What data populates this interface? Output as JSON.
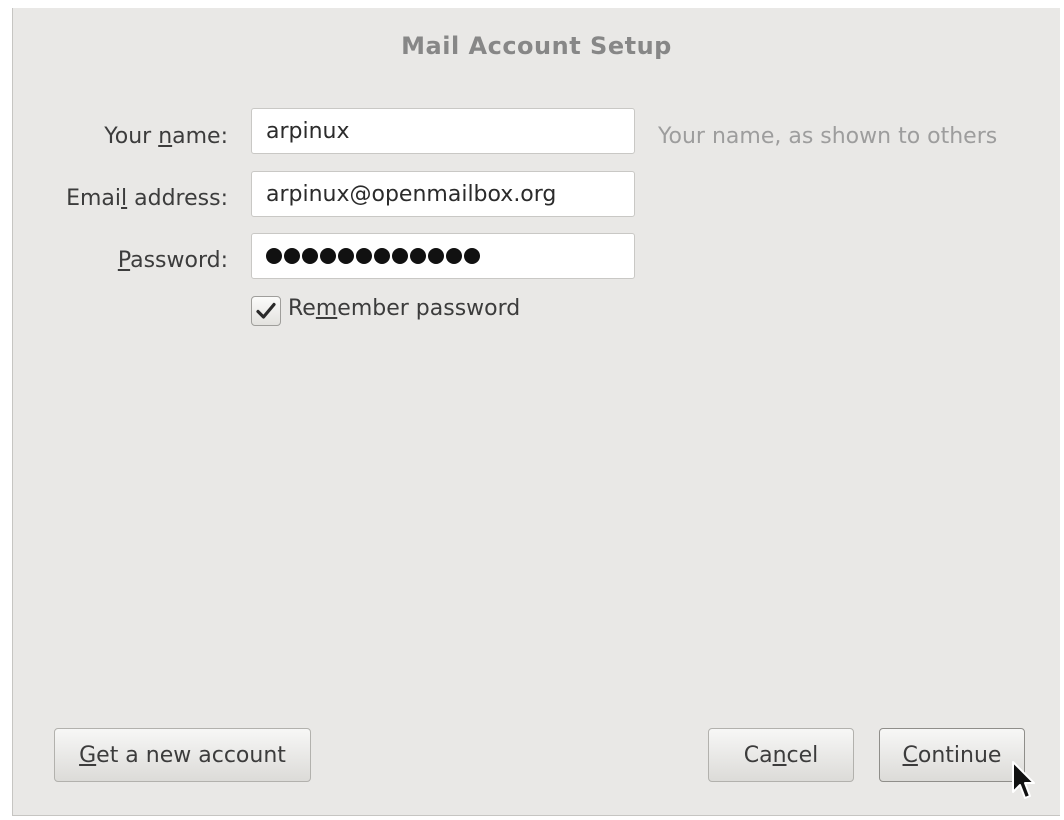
{
  "dialog": {
    "title": "Mail Account Setup"
  },
  "form": {
    "name": {
      "label_before": "Your ",
      "label_accel": "n",
      "label_after": "ame:",
      "value": "arpinux",
      "hint": "Your name, as shown to others"
    },
    "email": {
      "label_before": "Emai",
      "label_accel": "l",
      "label_after": " address:",
      "value": "arpinux@openmailbox.org"
    },
    "password": {
      "label_before": "",
      "label_accel": "P",
      "label_after": "assword:",
      "masked_length": 12
    },
    "remember": {
      "label_before": "Re",
      "label_accel": "m",
      "label_after": "ember password",
      "checked": true
    }
  },
  "buttons": {
    "new_account": {
      "before": "",
      "accel": "G",
      "after": "et a new account"
    },
    "cancel": {
      "before": "Ca",
      "accel": "n",
      "after": "cel"
    },
    "continue": {
      "before": "",
      "accel": "C",
      "after": "ontinue"
    }
  },
  "icons": {
    "checkmark": "check-icon",
    "cursor": "mouse-pointer-icon"
  }
}
